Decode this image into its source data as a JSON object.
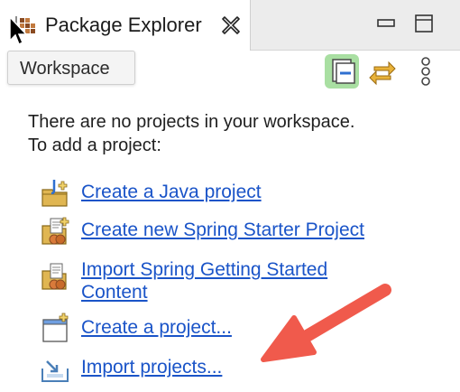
{
  "tab": {
    "title": "Package Explorer"
  },
  "tooltip": {
    "text": "Workspace"
  },
  "toolbar": {
    "collapse_icon": "collapse-all-icon",
    "link_icon": "link-with-editor-icon",
    "menu_icon": "view-menu-icon"
  },
  "message": {
    "line1": "There are no projects in your workspace.",
    "line2": "To add a project:"
  },
  "links": [
    {
      "label": "Create a Java project",
      "icon": "java-project-icon"
    },
    {
      "label": "Create new Spring Starter Project",
      "icon": "spring-starter-icon"
    },
    {
      "label_line1": "Import Spring Getting Started ",
      "label_line2": "Content",
      "icon": "spring-guide-icon"
    },
    {
      "label": "Create a project...",
      "icon": "new-project-icon"
    },
    {
      "label": "Import projects...",
      "icon": "import-projects-icon"
    }
  ],
  "colors": {
    "link": "#1a54c8",
    "arrow": "#f05a4c",
    "collapse_highlight": "#a9dfa2"
  }
}
